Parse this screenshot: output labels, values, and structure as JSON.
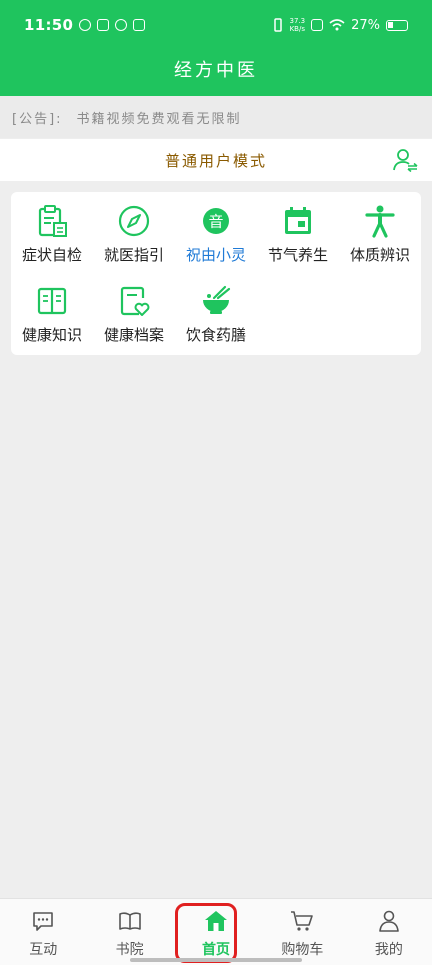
{
  "status_bar": {
    "time": "11:50",
    "net_speed_value": "37.3",
    "net_speed_unit": "KB/s",
    "battery": "27%"
  },
  "header": {
    "title": "经方中医"
  },
  "notice": {
    "tag": "[公告]:",
    "text": "书籍视频免费观看无限制"
  },
  "mode": {
    "label": "普通用户模式",
    "switch_icon": "user-switch-icon"
  },
  "grid": {
    "row1": [
      {
        "label": "症状自检",
        "icon": "clipboard-icon"
      },
      {
        "label": "就医指引",
        "icon": "compass-icon"
      },
      {
        "label": "祝由小灵",
        "icon": "yin-badge-icon",
        "badge": "音"
      },
      {
        "label": "节气养生",
        "icon": "calendar-icon"
      },
      {
        "label": "体质辨识",
        "icon": "body-figure-icon"
      }
    ],
    "row2": [
      {
        "label": "健康知识",
        "icon": "book-icon"
      },
      {
        "label": "健康档案",
        "icon": "health-record-icon"
      },
      {
        "label": "饮食药膳",
        "icon": "food-bowl-icon"
      }
    ]
  },
  "nav": {
    "items": [
      {
        "label": "互动",
        "icon": "chat-bubble-icon"
      },
      {
        "label": "书院",
        "icon": "open-book-icon"
      },
      {
        "label": "首页",
        "icon": "home-icon"
      },
      {
        "label": "购物车",
        "icon": "cart-icon"
      },
      {
        "label": "我的",
        "icon": "person-icon"
      }
    ],
    "active_index": 2
  },
  "colors": {
    "brand": "#1fc45e",
    "mode_text": "#8a5a00",
    "active_label": "#1f7ad6",
    "highlight": "#e02020"
  }
}
